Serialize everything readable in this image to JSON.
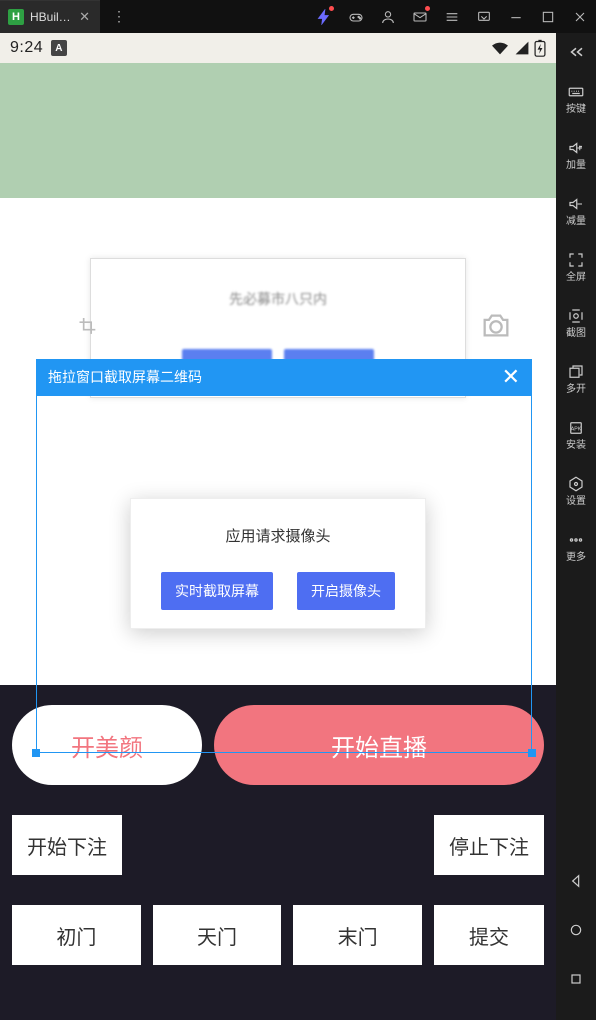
{
  "titlebar": {
    "tab_title": "HBuil…",
    "tooltip_icons": [
      "bolt",
      "gamepad",
      "user",
      "mail",
      "list",
      "expand",
      "minimize",
      "maximize",
      "close"
    ]
  },
  "sidepanel": {
    "items": [
      {
        "label": "按键"
      },
      {
        "label": "加量"
      },
      {
        "label": "减量"
      },
      {
        "label": "全屏"
      },
      {
        "label": "截图"
      },
      {
        "label": "多开"
      },
      {
        "label": "安装"
      },
      {
        "label": "设置"
      },
      {
        "label": "更多"
      }
    ]
  },
  "statusbar": {
    "time": "9:24",
    "indicator": "A"
  },
  "bg_card": {
    "title": "先必募市八只内"
  },
  "drag_overlay": {
    "title": "拖拉窗口截取屏幕二维码"
  },
  "center_dialog": {
    "msg": "应用请求摄像头",
    "btn_capture": "实时截取屏幕",
    "btn_camera": "开启摄像头"
  },
  "pills": {
    "beauty": "开美颜",
    "start_live": "开始直播"
  },
  "bet": {
    "start": "开始下注",
    "stop": "停止下注"
  },
  "gates": {
    "g1": "初门",
    "g2": "天门",
    "g3": "末门",
    "submit": "提交"
  }
}
